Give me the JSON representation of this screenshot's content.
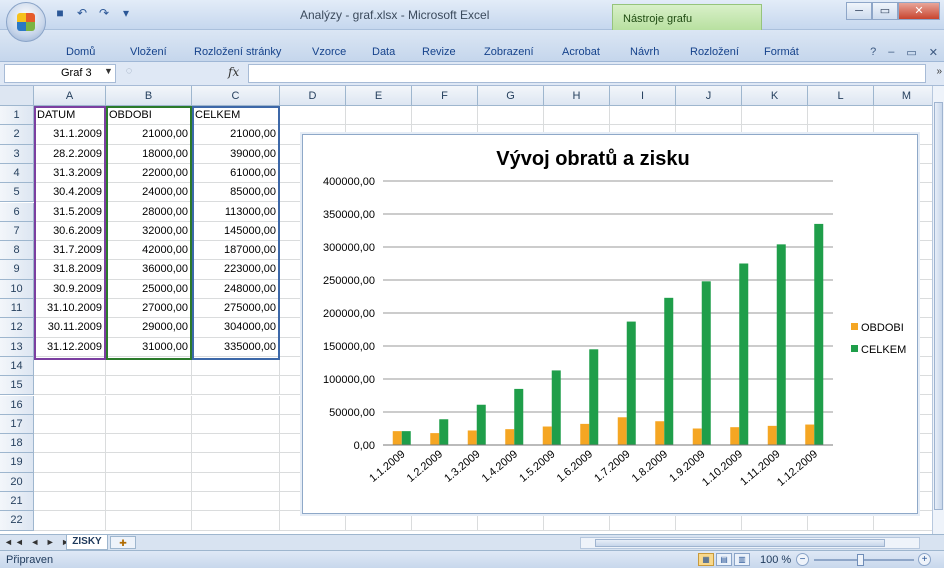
{
  "window": {
    "title": "Analýzy - graf.xlsx - Microsoft Excel",
    "context_tab": "Nástroje grafu",
    "minimize_label": "─",
    "maximize_label": "▭",
    "close_label": "✕"
  },
  "qat": {
    "save_icon": "save-icon",
    "undo_icon": "undo-icon",
    "redo_icon": "redo-icon"
  },
  "ribbon": {
    "tabs": [
      "Domů",
      "Vložení",
      "Rozložení stránky",
      "Vzorce",
      "Data",
      "Revize",
      "Zobrazení",
      "Acrobat",
      "Návrh",
      "Rozložení",
      "Formát"
    ],
    "help_label": "?"
  },
  "formula_bar": {
    "name_box": "Graf 3",
    "fx": "fx",
    "formula": ""
  },
  "sheet": {
    "columns": [
      "A",
      "B",
      "C",
      "D",
      "E",
      "F",
      "G",
      "H",
      "I",
      "J",
      "K",
      "L",
      "M"
    ],
    "rows": [
      "1",
      "2",
      "3",
      "4",
      "5",
      "6",
      "7",
      "8",
      "9",
      "10",
      "11",
      "12",
      "13",
      "14",
      "15",
      "16",
      "17",
      "18",
      "19",
      "20",
      "21",
      "22"
    ],
    "headers": [
      "DATUM",
      "OBDOBI",
      "CELKEM"
    ],
    "data": [
      [
        "31.1.2009",
        "21000,00",
        "21000,00"
      ],
      [
        "28.2.2009",
        "18000,00",
        "39000,00"
      ],
      [
        "31.3.2009",
        "22000,00",
        "61000,00"
      ],
      [
        "30.4.2009",
        "24000,00",
        "85000,00"
      ],
      [
        "31.5.2009",
        "28000,00",
        "113000,00"
      ],
      [
        "30.6.2009",
        "32000,00",
        "145000,00"
      ],
      [
        "31.7.2009",
        "42000,00",
        "187000,00"
      ],
      [
        "31.8.2009",
        "36000,00",
        "223000,00"
      ],
      [
        "30.9.2009",
        "25000,00",
        "248000,00"
      ],
      [
        "31.10.2009",
        "27000,00",
        "275000,00"
      ],
      [
        "30.11.2009",
        "29000,00",
        "304000,00"
      ],
      [
        "31.12.2009",
        "31000,00",
        "335000,00"
      ]
    ]
  },
  "chart_data": {
    "type": "bar",
    "title": "Vývoj obratů a zisku",
    "categories": [
      "1.1.2009",
      "1.2.2009",
      "1.3.2009",
      "1.4.2009",
      "1.5.2009",
      "1.6.2009",
      "1.7.2009",
      "1.8.2009",
      "1.9.2009",
      "1.10.2009",
      "1.11.2009",
      "1.12.2009"
    ],
    "series": [
      {
        "name": "OBDOBI",
        "color": "#f5a623",
        "values": [
          21000,
          18000,
          22000,
          24000,
          28000,
          32000,
          42000,
          36000,
          25000,
          27000,
          29000,
          31000
        ]
      },
      {
        "name": "CELKEM",
        "color": "#1f9e4a",
        "values": [
          21000,
          39000,
          61000,
          85000,
          113000,
          145000,
          187000,
          223000,
          248000,
          275000,
          304000,
          335000
        ]
      }
    ],
    "y_ticks": [
      "0,00",
      "50000,00",
      "100000,00",
      "150000,00",
      "200000,00",
      "250000,00",
      "300000,00",
      "350000,00",
      "400000,00"
    ],
    "ylim": [
      0,
      400000
    ],
    "grid": true,
    "legend": "right"
  },
  "tabs_bar": {
    "sheet_name": "ZISKY",
    "nav": "◄◄ ◄ ► ►►"
  },
  "status": {
    "ready": "Připraven",
    "zoom": "100 %",
    "zoom_value": 100
  }
}
